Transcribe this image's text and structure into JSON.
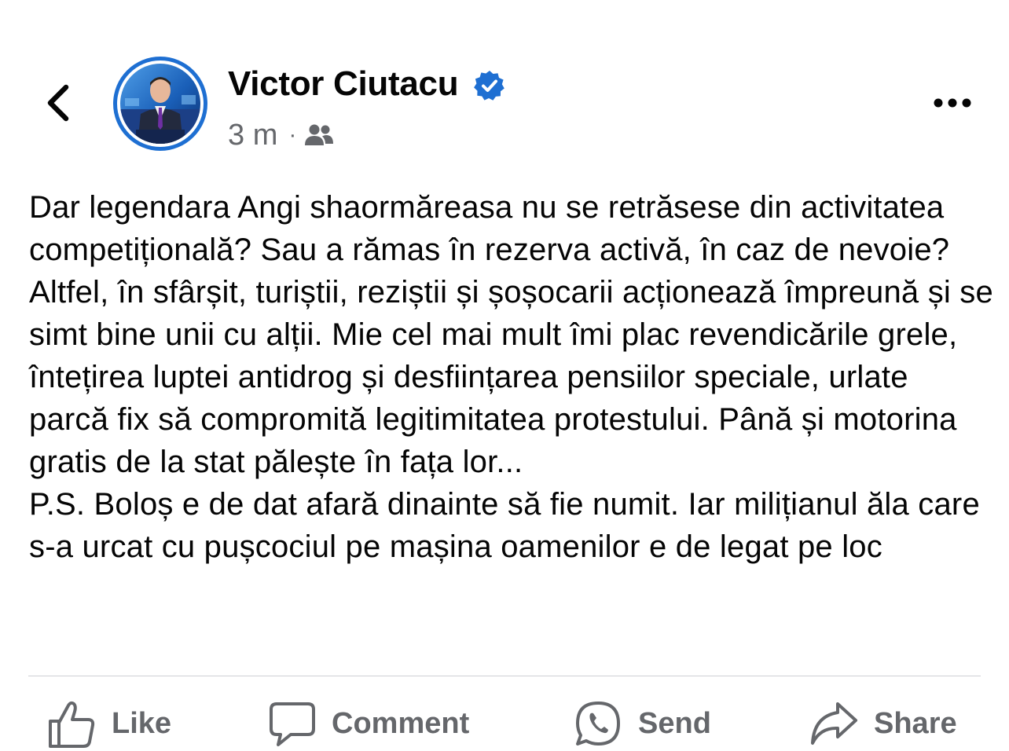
{
  "post": {
    "author": {
      "name": "Victor Ciutacu",
      "verified": true,
      "avatar": "avatar-photo-news-anchor"
    },
    "timestamp": "3 m",
    "separator": "·",
    "audience_icon": "friends-icon",
    "text": "Dar legendara Angi shaormăreasa nu se retrăsese din activitatea competițională? Sau a rămas în rezerva activă, în caz de nevoie? Altfel, în sfârșit, turiștii, reziștii și șoșocarii acționează împreună și se simt bine unii cu alții. Mie cel mai mult îmi plac revendicările grele, întețirea luptei antidrog și desființarea pensiilor speciale, urlate parcă fix să compromită legitimitatea protestului. Până și motorina gratis de la stat pălește în fața lor...\nP.S. Boloș e de dat afară dinainte să fie numit. Iar milițianul ăla care s-a urcat cu pușcociul pe mașina oamenilor e de legat pe loc"
  },
  "header": {
    "back_icon": "chevron-left-icon",
    "more_icon": "more-horizontal-icon"
  },
  "actions": [
    {
      "label": "Like",
      "icon": "thumbs-up-icon"
    },
    {
      "label": "Comment",
      "icon": "comment-icon"
    },
    {
      "label": "Send",
      "icon": "whatsapp-icon"
    },
    {
      "label": "Share",
      "icon": "share-arrow-icon"
    }
  ],
  "colors": {
    "verified_badge": "#1e6fd2",
    "avatar_ring": "#1e6fd2",
    "text_primary": "#050505",
    "text_secondary": "#65676b",
    "divider": "#ced0d4"
  }
}
